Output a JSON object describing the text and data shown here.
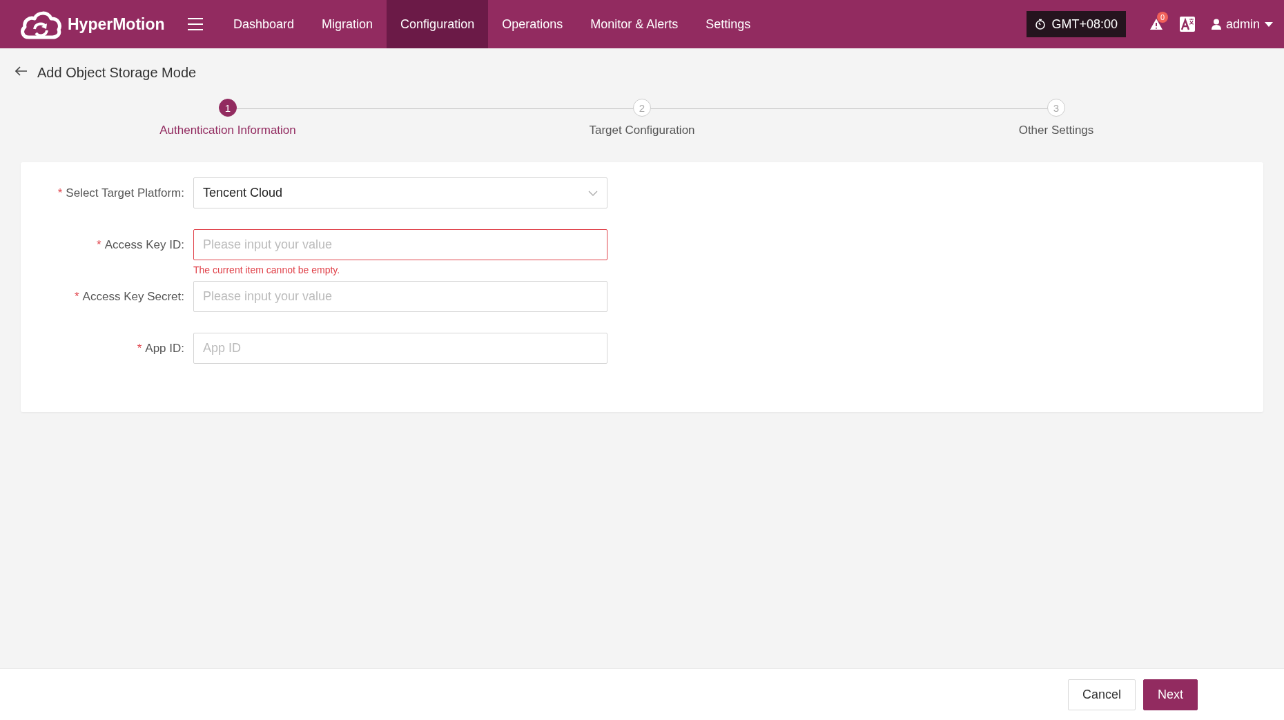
{
  "header": {
    "brand": "HyperMotion",
    "nav": [
      {
        "label": "Dashboard",
        "selected": false
      },
      {
        "label": "Migration",
        "selected": false
      },
      {
        "label": "Configuration",
        "selected": true
      },
      {
        "label": "Operations",
        "selected": false
      },
      {
        "label": "Monitor & Alerts",
        "selected": false
      },
      {
        "label": "Settings",
        "selected": false
      }
    ],
    "timezone": "GMT+08:00",
    "alert_count": "0",
    "user": "admin"
  },
  "page_title": "Add Object Storage Mode",
  "steps": [
    {
      "number": "1",
      "label": "Authentication Information",
      "selected": true
    },
    {
      "number": "2",
      "label": "Target Configuration",
      "selected": false
    },
    {
      "number": "3",
      "label": "Other Settings",
      "selected": false
    }
  ],
  "form": {
    "fields": [
      {
        "kind": "select",
        "label": "Select Target Platform:",
        "required_mark": "*",
        "value": "Tencent Cloud"
      },
      {
        "kind": "input",
        "label": "Access Key ID:",
        "required_mark": "*",
        "placeholder": "Please input your value",
        "error": "The current item cannot be empty."
      },
      {
        "kind": "input",
        "label": "Access Key Secret:",
        "required_mark": "*",
        "placeholder": "Please input your value"
      },
      {
        "kind": "input",
        "label": "App ID:",
        "required_mark": "*",
        "placeholder": "App ID"
      }
    ]
  },
  "footer": {
    "buttons": [
      {
        "label": "Cancel",
        "kind": "secondary"
      },
      {
        "label": "Next",
        "kind": "primary"
      }
    ]
  }
}
